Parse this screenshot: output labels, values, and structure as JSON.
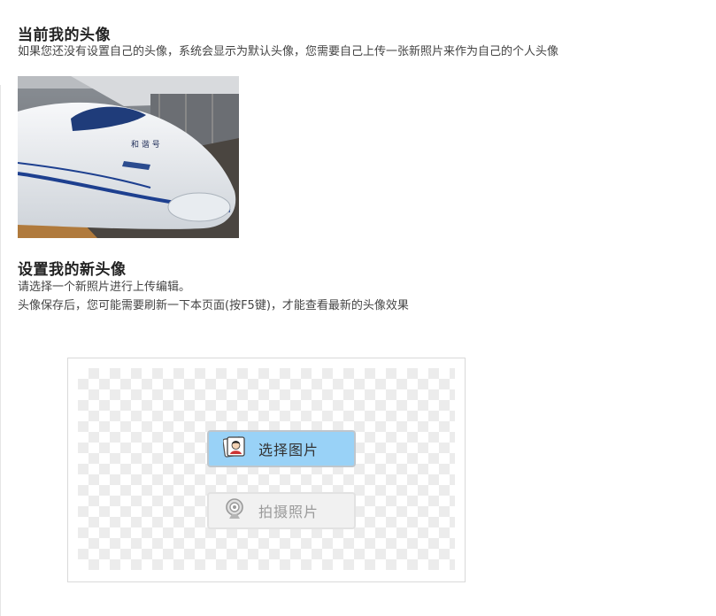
{
  "current": {
    "title": "当前我的头像",
    "description": "如果您还没有设置自己的头像，系统会显示为默认头像，您需要自己上传一张新照片来作为自己的个人头像"
  },
  "new": {
    "title": "设置我的新头像",
    "line1": "请选择一个新照片进行上传编辑。",
    "line2": "头像保存后，您可能需要刷新一下本页面(按F5键)，才能查看最新的头像效果"
  },
  "buttons": {
    "select_label": "选择图片",
    "capture_label": "拍摄照片",
    "select_icon": "photo-portrait-icon",
    "capture_icon": "webcam-icon"
  },
  "colors": {
    "select_bg": "#99d2f7",
    "capture_bg": "#f1f1f1"
  }
}
